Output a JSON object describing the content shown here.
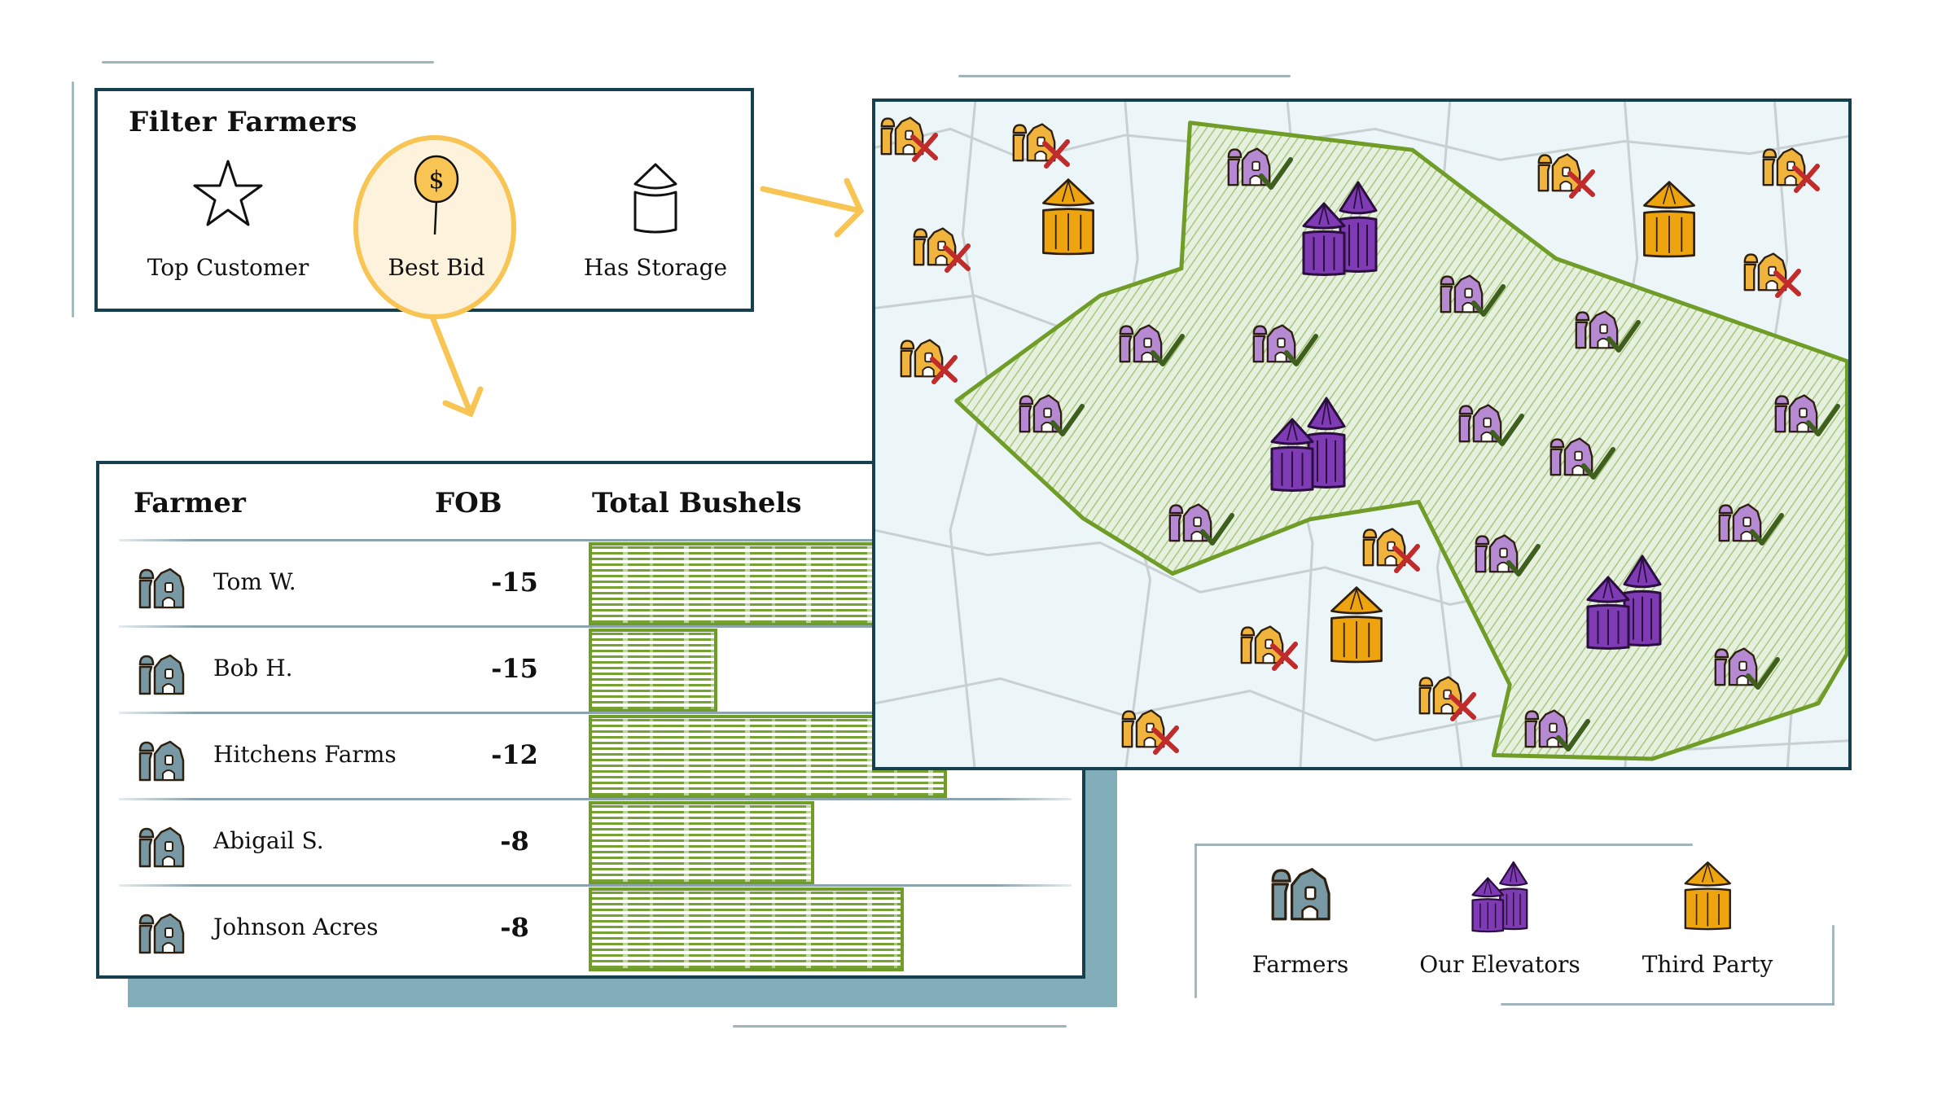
{
  "filter": {
    "title": "Filter Farmers",
    "options": [
      {
        "label": "Top Customer",
        "icon": "star-icon",
        "selected": false
      },
      {
        "label": "Best Bid",
        "icon": "dollar-pin-icon",
        "selected": true
      },
      {
        "label": "Has Storage",
        "icon": "silo-icon",
        "selected": false
      }
    ]
  },
  "table": {
    "columns": [
      "Farmer",
      "FOB",
      "Total Bushels"
    ],
    "rows": [
      {
        "farmer": "Tom W.",
        "fob": "-15",
        "bushels_relative": 0.95
      },
      {
        "farmer": "Bob H.",
        "fob": "-15",
        "bushels_relative": 0.36
      },
      {
        "farmer": "Hitchens Farms",
        "fob": "-12",
        "bushels_relative": 1.0
      },
      {
        "farmer": "Abigail S.",
        "fob": "-8",
        "bushels_relative": 0.63
      },
      {
        "farmer": "Johnson Acres",
        "fob": "-8",
        "bushels_relative": 0.88
      }
    ]
  },
  "chart_data": {
    "type": "bar",
    "title": "Total Bushels",
    "categories": [
      "Tom W.",
      "Bob H.",
      "Hitchens Farms",
      "Abigail S.",
      "Johnson Acres"
    ],
    "values": [
      0.95,
      0.36,
      1.0,
      0.63,
      0.88
    ],
    "xlabel": "",
    "ylabel": "",
    "note": "relative bar lengths; no axis shown"
  },
  "map": {
    "markers": {
      "rejected_farmers": 11,
      "approved_farmers": 14,
      "our_elevators": 3,
      "third_party_elevators": 3
    },
    "region": "service area (hatched green)"
  },
  "legend": {
    "items": [
      {
        "label": "Farmers",
        "icon": "farmer-barn-icon"
      },
      {
        "label": "Our Elevators",
        "icon": "our-elevator-icon"
      },
      {
        "label": "Third Party",
        "icon": "third-party-elevator-icon"
      }
    ]
  },
  "colors": {
    "border": "#163f4f",
    "highlight": "#f8c453",
    "green": "#6f9d28",
    "purple_elevator": "#7e3bb3",
    "orange": "#eda40e",
    "farmer_blue": "#7899a4",
    "farmer_member": "#b68ad3",
    "farmer_other": "#f0b43d",
    "reject_red": "#c02b2b",
    "check_green": "#3f5f1e",
    "shadow": "#82aeba",
    "map_bg": "#ecf5f7"
  }
}
